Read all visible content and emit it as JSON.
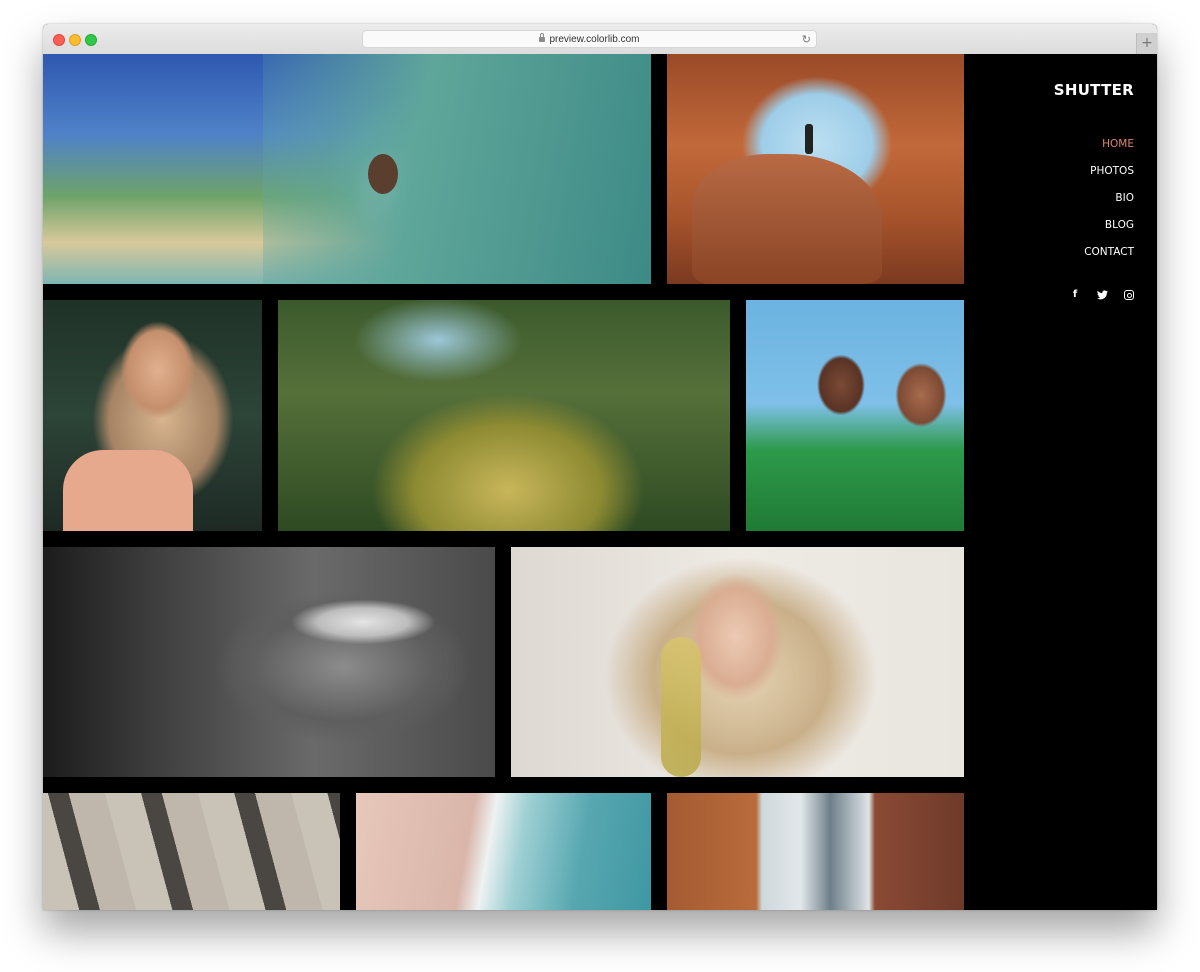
{
  "browser": {
    "url": "preview.colorlib.com",
    "lock_icon": "lock-icon",
    "reload_icon": "↻",
    "new_tab_icon": "+"
  },
  "site": {
    "brand": "SHUTTER",
    "accent_color": "#e08470",
    "nav": [
      {
        "label": "HOME",
        "active": true
      },
      {
        "label": "PHOTOS",
        "active": false
      },
      {
        "label": "BIO",
        "active": false
      },
      {
        "label": "BLOG",
        "active": false
      },
      {
        "label": "CONTACT",
        "active": false
      }
    ],
    "social": [
      {
        "name": "facebook",
        "glyph": "f"
      },
      {
        "name": "twitter",
        "glyph": "🐦"
      },
      {
        "name": "instagram",
        "glyph": ""
      }
    ]
  },
  "gallery": {
    "rows": [
      [
        {
          "name": "photo-surfer-wave",
          "subject": "Surfer inside a wave barrel"
        },
        {
          "name": "photo-rock-arch",
          "subject": "Person standing in a red rock arch"
        }
      ],
      [
        {
          "name": "photo-smiling-woman-lights",
          "subject": "Smiling woman with string lights"
        },
        {
          "name": "photo-mossy-tree",
          "subject": "Moss-covered tree trunk"
        },
        {
          "name": "photo-two-women",
          "subject": "Two smiling women under blue sky"
        }
      ],
      [
        {
          "name": "photo-bw-smile",
          "subject": "Black and white close-up of a smile"
        },
        {
          "name": "photo-blonde-woman",
          "subject": "Blonde woman behind yellow flowers"
        }
      ],
      [
        {
          "name": "photo-building-facade",
          "subject": "Building facade windows"
        },
        {
          "name": "photo-beach-aerial",
          "subject": "Aerial view of surf on sand"
        },
        {
          "name": "photo-bridge-street",
          "subject": "Street with bridge between brick buildings"
        }
      ]
    ]
  }
}
